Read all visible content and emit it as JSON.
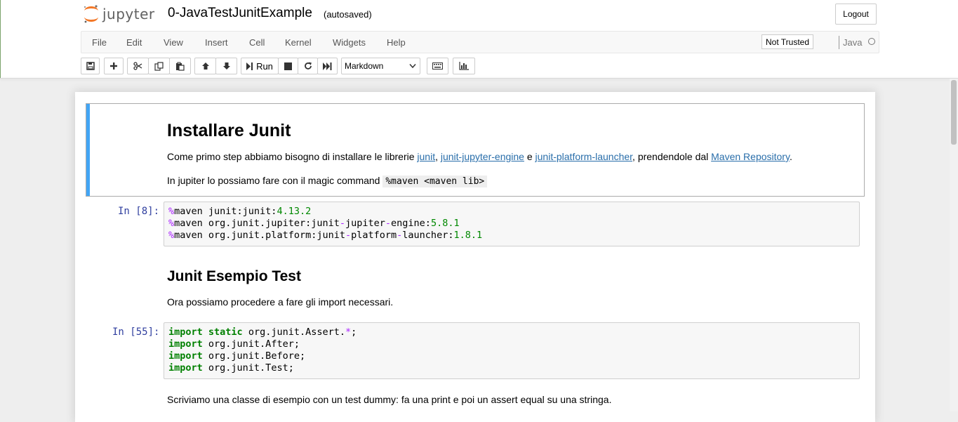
{
  "header": {
    "logo_text": "jupyter",
    "notebook_name": "0-JavaTestJunitExample",
    "autosave_status": "(autosaved)",
    "logout_label": "Logout"
  },
  "menu": {
    "items": [
      "File",
      "Edit",
      "View",
      "Insert",
      "Cell",
      "Kernel",
      "Widgets",
      "Help"
    ],
    "trust_status": "Not Trusted",
    "kernel_name": "Java"
  },
  "toolbar": {
    "run_label": "Run",
    "cell_type": "Markdown",
    "icons": [
      "save-icon",
      "plus-icon",
      "cut-icon",
      "copy-icon",
      "paste-icon",
      "arrow-up-icon",
      "arrow-down-icon",
      "run-icon",
      "stop-icon",
      "restart-icon",
      "fast-forward-icon",
      "keyboard-icon",
      "bar-chart-icon"
    ]
  },
  "cells": {
    "md1": {
      "heading": "Installare Junit",
      "p1_before": "Come primo step abbiamo bisogno di installare le librerie ",
      "link_junit": "junit",
      "sep1": ", ",
      "link_engine": "junit-jupyter-engine",
      "sep2": " e ",
      "link_launcher": "junit-platform-launcher",
      "p1_mid": ", prendendole dal ",
      "link_maven": "Maven Repository",
      "p1_end": ".",
      "p2_before": "In jupiter lo possiamo fare con il magic command ",
      "p2_code": "%maven <maven lib>"
    },
    "code1": {
      "prompt": "In [8]:",
      "lines": [
        {
          "op": "%",
          "text": "maven junit:junit:",
          "ver": "4.13.2"
        },
        {
          "op": "%",
          "text": "maven org.junit.jupiter:junit",
          "dash": "-",
          "text2": "jupiter",
          "dash2": "-",
          "text3": "engine:",
          "ver": "5.8.1"
        },
        {
          "op": "%",
          "text": "maven org.junit.platform:junit",
          "dash": "-",
          "text2": "platform",
          "dash2": "-",
          "text3": "launcher:",
          "ver": "1.8.1"
        }
      ]
    },
    "md2": {
      "heading": "Junit Esempio Test",
      "text": "Ora possiamo procedere a fare gli import necessari."
    },
    "code2": {
      "prompt": "In [55]:",
      "kw_import": "import",
      "kw_static": "static",
      "line1_rest": " org.junit.Assert.",
      "line1_star": "*",
      "line1_end": ";",
      "line2_rest": " org.junit.After;",
      "line3_rest": " org.junit.Before;",
      "line4_rest": " org.junit.Test;"
    },
    "md3": {
      "text": "Scriviamo una classe di esempio con un test dummy: fa una print e poi un assert equal su una stringa."
    }
  },
  "colors": {
    "selected_cell_bar": "#42a5f5",
    "prompt": "#303f9f",
    "keyword": "#008000",
    "number": "#008800",
    "operator": "#aa22ff",
    "link": "#296eaa"
  }
}
